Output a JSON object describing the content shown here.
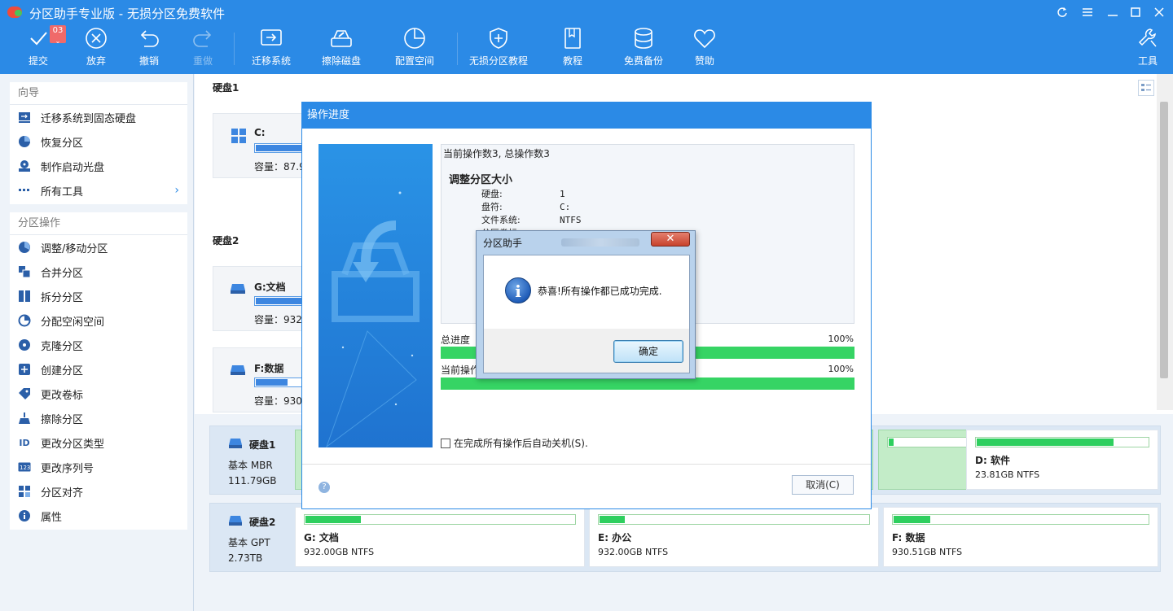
{
  "app": {
    "title": "分区助手专业版 - 无损分区免费软件",
    "window_controls": [
      "refresh-icon",
      "menu-icon",
      "minimize-icon",
      "maximize-icon",
      "close-icon"
    ]
  },
  "toolbar": {
    "commit": {
      "label": "提交",
      "badge": "03",
      "icon": "check-icon"
    },
    "discard": {
      "label": "放弃",
      "icon": "circle-x-icon"
    },
    "undo": {
      "label": "撤销",
      "icon": "undo-icon"
    },
    "redo": {
      "label": "重做",
      "icon": "redo-icon",
      "disabled": true
    },
    "migrate": {
      "label": "迁移系统",
      "icon": "migrate-icon"
    },
    "wipe": {
      "label": "擦除磁盘",
      "icon": "wipe-disk-icon"
    },
    "allocate": {
      "label": "配置空间",
      "icon": "pie-icon"
    },
    "tutorial_lossless": {
      "label": "无损分区教程",
      "icon": "shield-plus-icon"
    },
    "tutorial": {
      "label": "教程",
      "icon": "book-icon"
    },
    "backup": {
      "label": "免费备份",
      "icon": "database-icon"
    },
    "sponsor": {
      "label": "赞助",
      "icon": "heart-icon"
    },
    "tools": {
      "label": "工具",
      "icon": "wrench-icon"
    }
  },
  "sidebar": {
    "wizard": {
      "heading": "向导",
      "items": [
        {
          "label": "迁移系统到固态硬盘",
          "icon": "migrate-ssd-icon"
        },
        {
          "label": "恢复分区",
          "icon": "recover-icon"
        },
        {
          "label": "制作启动光盘",
          "icon": "boot-disc-icon"
        },
        {
          "label": "所有工具",
          "icon": "more-icon"
        }
      ]
    },
    "partition_ops": {
      "heading": "分区操作",
      "items": [
        {
          "label": "调整/移动分区",
          "icon": "resize-icon"
        },
        {
          "label": "合并分区",
          "icon": "merge-icon"
        },
        {
          "label": "拆分分区",
          "icon": "split-icon"
        },
        {
          "label": "分配空闲空间",
          "icon": "allocate-icon"
        },
        {
          "label": "克隆分区",
          "icon": "clone-icon"
        },
        {
          "label": "创建分区",
          "icon": "create-icon"
        },
        {
          "label": "更改卷标",
          "icon": "label-icon"
        },
        {
          "label": "擦除分区",
          "icon": "broom-icon"
        },
        {
          "label": "更改分区类型",
          "icon": "id-icon"
        },
        {
          "label": "更改序列号",
          "icon": "serial-icon"
        },
        {
          "label": "分区对齐",
          "icon": "align-icon"
        },
        {
          "label": "属性",
          "icon": "info-icon"
        }
      ]
    }
  },
  "upper": {
    "disk1": {
      "title": "硬盘1",
      "partitions": [
        {
          "name": "C:",
          "capacity": "容量：87.98",
          "used_pct": 100
        }
      ]
    },
    "disk2": {
      "title": "硬盘2",
      "partitions": [
        {
          "name": "G:文档",
          "capacity": "容量：932.0",
          "used_pct": 100
        },
        {
          "name": "F:数据",
          "capacity": "容量：930.5",
          "used_pct": 70
        }
      ]
    }
  },
  "lower": {
    "disk1": {
      "name": "硬盘1",
      "type": "基本 MBR",
      "size": "111.79GB",
      "partitions": [
        {
          "name": "D: 软件",
          "fs": "23.81GB NTFS",
          "used_pct": 80
        }
      ]
    },
    "disk2": {
      "name": "硬盘2",
      "type": "基本 GPT",
      "size": "2.73TB",
      "partitions": [
        {
          "name": "G: 文档",
          "fs": "932.00GB NTFS",
          "used_pct": 21
        },
        {
          "name": "E: 办公",
          "fs": "932.00GB NTFS",
          "used_pct": 10
        },
        {
          "name": "F: 数据",
          "fs": "930.51GB NTFS",
          "used_pct": 15
        }
      ]
    }
  },
  "progress_dialog": {
    "title": "操作进度",
    "header": "当前操作数3, 总操作数3",
    "operation": "调整分区大小",
    "details": [
      {
        "key": "硬盘:",
        "value": "1"
      },
      {
        "key": "盘符:",
        "value": "C:"
      },
      {
        "key": "文件系统:",
        "value": "NTFS"
      },
      {
        "key": "分区卷标:",
        "value": ""
      }
    ],
    "total_label": "总进度",
    "total_pct_text": "100%",
    "total_pct": 100,
    "current_label": "当前操作",
    "current_pct_text": "100%",
    "current_pct": 100,
    "shutdown_checkbox": "在完成所有操作后自动关机(S).",
    "shutdown_checked": false,
    "cancel_label": "取消(C)",
    "help_icon": "help-icon"
  },
  "message_box": {
    "title": "分区助手",
    "message": "恭喜!所有操作都已成功完成.",
    "ok_label": "确定",
    "icon": "info-icon",
    "close_icon": "close-icon"
  },
  "colors": {
    "accent": "#2b8ae6",
    "progress_green": "#36d464",
    "part_green": "#2ecf5e",
    "badge_red": "#f06a6a"
  }
}
